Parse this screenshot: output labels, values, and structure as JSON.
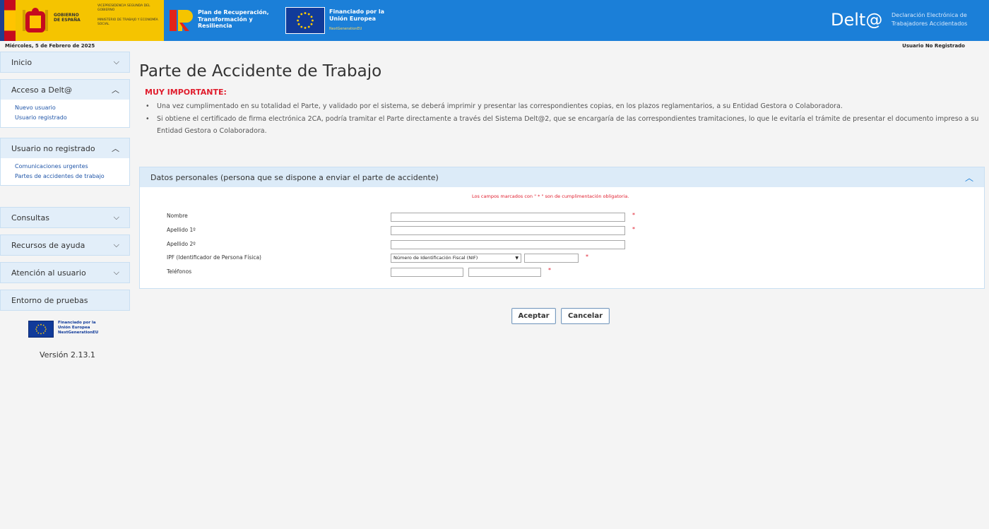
{
  "header": {
    "gov_label": "GOBIERNO DE ESPAÑA",
    "vice_label": "VICEPRESIDENCIA SEGUNDA DEL GOBIERNO",
    "ministry_label": "MINISTERIO DE TRABAJO Y ECONOMÍA SOCIAL",
    "plan_label": "Plan de Recuperación, Transformación y Resiliencia",
    "eu_label": "Financiado por la Unión Europea",
    "eu_sub": "NextGenerationEU",
    "brand": "Delt@",
    "brand_sub": "Declaración Electrónica de Trabajadores Accidentados"
  },
  "infobar": {
    "date": "Miércoles, 5 de Febrero de 2025",
    "user_status": "Usuario No Registrado"
  },
  "sidebar": {
    "inicio": "Inicio",
    "acceso": {
      "title": "Acceso a Delt@",
      "links": [
        "Nuevo usuario",
        "Usuario registrado"
      ]
    },
    "no_registrado": {
      "title": "Usuario no registrado",
      "links": [
        "Comunicaciones urgentes",
        "Partes de accidentes de trabajo"
      ]
    },
    "consultas": "Consultas",
    "recursos": "Recursos de ayuda",
    "atencion": "Atención al usuario",
    "entorno": "Entorno de pruebas",
    "eu_text": "Financiado por la Unión Europea NextGenerationEU",
    "version": "Versión 2.13.1"
  },
  "main": {
    "title": "Parte de Accidente de Trabajo",
    "important": "MUY IMPORTANTE:",
    "notes": [
      "Una vez cumplimentado en su totalidad el Parte, y validado por el sistema, se deberá imprimir y presentar las correspondientes copias, en los plazos reglamentarios, a su Entidad Gestora o Colaboradora.",
      "Si obtiene el certificado de firma electrónica 2CA, podría tramitar el Parte directamente a través del Sistema Delt@2, que se encargaría de las correspondientes tramitaciones, lo que le evitaría el trámite de presentar el documento impreso a su Entidad Gestora o Colaboradora."
    ]
  },
  "panel": {
    "title": "Datos personales (persona que se dispone a enviar el parte de accidente)",
    "required_note": "Los campos marcados con \" * \" son de cumplimentación obligatoria.",
    "fields": {
      "nombre": "Nombre",
      "apellido1": "Apellido 1º",
      "apellido2": "Apellido 2º",
      "ipf": "IPF (Identificador de Persona Física)",
      "telefonos": "Teléfonos"
    },
    "ipf_selected": "Número de Identificación Fiscal (NIF)",
    "star": "*"
  },
  "buttons": {
    "accept": "Aceptar",
    "cancel": "Cancelar"
  },
  "colors": {
    "banner": "#1b7fd8",
    "gov_yellow": "#f5c400",
    "menu_head": "#e2eef9",
    "required_red": "#e01d2d",
    "link_blue": "#1f55a8"
  }
}
